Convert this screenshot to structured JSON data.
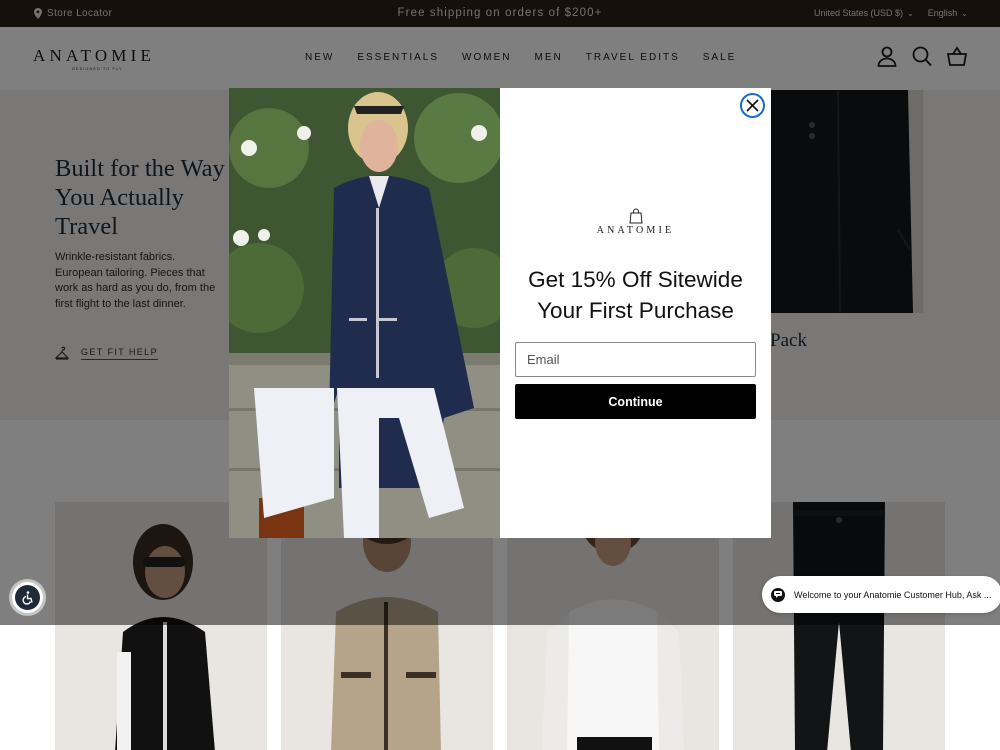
{
  "announcement": {
    "store_locator": "Store Locator",
    "shipping": "Free shipping on orders of $200+",
    "currency": "United States (USD $)",
    "language": "English"
  },
  "header": {
    "logo": "ANATOMIE",
    "logo_tagline": "DESIGNED TO FLY",
    "nav": [
      "NEW",
      "ESSENTIALS",
      "WOMEN",
      "MEN",
      "TRAVEL EDITS",
      "SALE"
    ]
  },
  "hero": {
    "title": "Built for the Way You Actually Travel",
    "description": "Wrinkle-resistant fabrics. European tailoring. Pieces that work as hard as you do, from the first flight to the last dinner.",
    "fit_help": "GET FIT HELP",
    "collection_label_partial": "t Pack"
  },
  "modal": {
    "logo": "ANATOMIE",
    "headline_line1": "Get 15% Off Sitewide",
    "headline_line2": "Your First Purchase",
    "email_placeholder": "Email",
    "continue_label": "Continue"
  },
  "chat": {
    "message": "Welcome to your Anatomie Customer Hub, Ask ..."
  },
  "colors": {
    "announcement_bg": "#2c2117",
    "button_bg": "#000000",
    "close_ring": "#1b6ac9",
    "hero_title": "#1b2c3b"
  }
}
